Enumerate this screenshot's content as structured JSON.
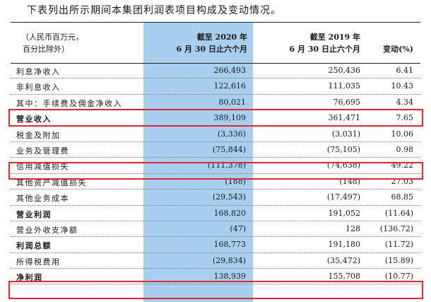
{
  "intro": "下表列出所示期间本集团利润表项目构成及变动情况。",
  "header": {
    "unit_line1": "（人民币百万元，",
    "unit_line2": "百分比除外）",
    "col1_line1": "截至 2020 年",
    "col1_line2": "6 月 30 日止六个月",
    "col2_line1": "截至 2019 年",
    "col2_line2": "6 月 30 日止六个月",
    "col3": "变动(%)"
  },
  "rows": [
    {
      "label": "利息净收入",
      "v2020": "266,493",
      "v2019": "250,436",
      "change": "6.41",
      "bold": false
    },
    {
      "label": "非利息收入",
      "v2020": "122,616",
      "v2019": "111,035",
      "change": "10.43",
      "bold": false
    },
    {
      "label": "其中：手续费及佣金净收入",
      "v2020": "80,021",
      "v2019": "76,695",
      "change": "4.34",
      "bold": false
    },
    {
      "label": "营业收入",
      "v2020": "389,109",
      "v2019": "361,471",
      "change": "7.65",
      "bold": true
    },
    {
      "label": "税金及附加",
      "v2020": "(3,336)",
      "v2019": "(3,031)",
      "change": "10.06",
      "bold": false
    },
    {
      "label": "业务及管理费",
      "v2020": "(75,844)",
      "v2019": "(75,105)",
      "change": "0.98",
      "bold": false
    },
    {
      "label": "信用减值损失",
      "v2020": "(111,378)",
      "v2019": "(74,638)",
      "change": "49.22",
      "bold": false
    },
    {
      "label": "其他资产减值损失",
      "v2020": "(188)",
      "v2019": "(148)",
      "change": "27.03",
      "bold": false
    },
    {
      "label": "其他业务成本",
      "v2020": "(29,543)",
      "v2019": "(17,497)",
      "change": "68.85",
      "bold": false
    },
    {
      "label": "营业利润",
      "v2020": "168,820",
      "v2019": "191,052",
      "change": "(11.64)",
      "bold": true
    },
    {
      "label": "营业外收支净额",
      "v2020": "(47)",
      "v2019": "128",
      "change": "(136.72)",
      "bold": false
    },
    {
      "label": "利润总额",
      "v2020": "168,773",
      "v2019": "191,180",
      "change": "(11.72)",
      "bold": true
    },
    {
      "label": "所得税费用",
      "v2020": "(29,834)",
      "v2019": "(35,472)",
      "change": "(15.89)",
      "bold": false
    },
    {
      "label": "净利润",
      "v2020": "138,939",
      "v2019": "155,708",
      "change": "(10.77)",
      "bold": true
    }
  ],
  "colors": {
    "highlight_column": "#a8cef0",
    "red_box": "#e0262e"
  }
}
